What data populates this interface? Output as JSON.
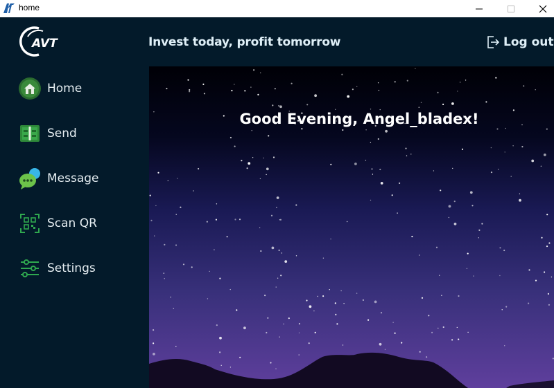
{
  "window": {
    "title": "home",
    "icon": "avt-app-icon"
  },
  "header": {
    "logo_text": "AVT",
    "tagline": "Invest today, profit tomorrow",
    "logout_label": "Log out",
    "logout_icon": "logout-icon"
  },
  "sidebar": {
    "items": [
      {
        "label": "Home",
        "icon": "home-icon"
      },
      {
        "label": "Send",
        "icon": "send-icon"
      },
      {
        "label": "Message",
        "icon": "message-icon"
      },
      {
        "label": "Scan QR",
        "icon": "qr-scan-icon"
      },
      {
        "label": "Settings",
        "icon": "settings-sliders-icon"
      }
    ]
  },
  "main": {
    "greeting": "Good Evening, Angel_bladex!"
  },
  "colors": {
    "app_background": "#031a2a",
    "text_light": "#dfeff7",
    "accent_green": "#2fa84f",
    "sky_top": "#02020a",
    "sky_bottom": "#5a3b9a"
  }
}
